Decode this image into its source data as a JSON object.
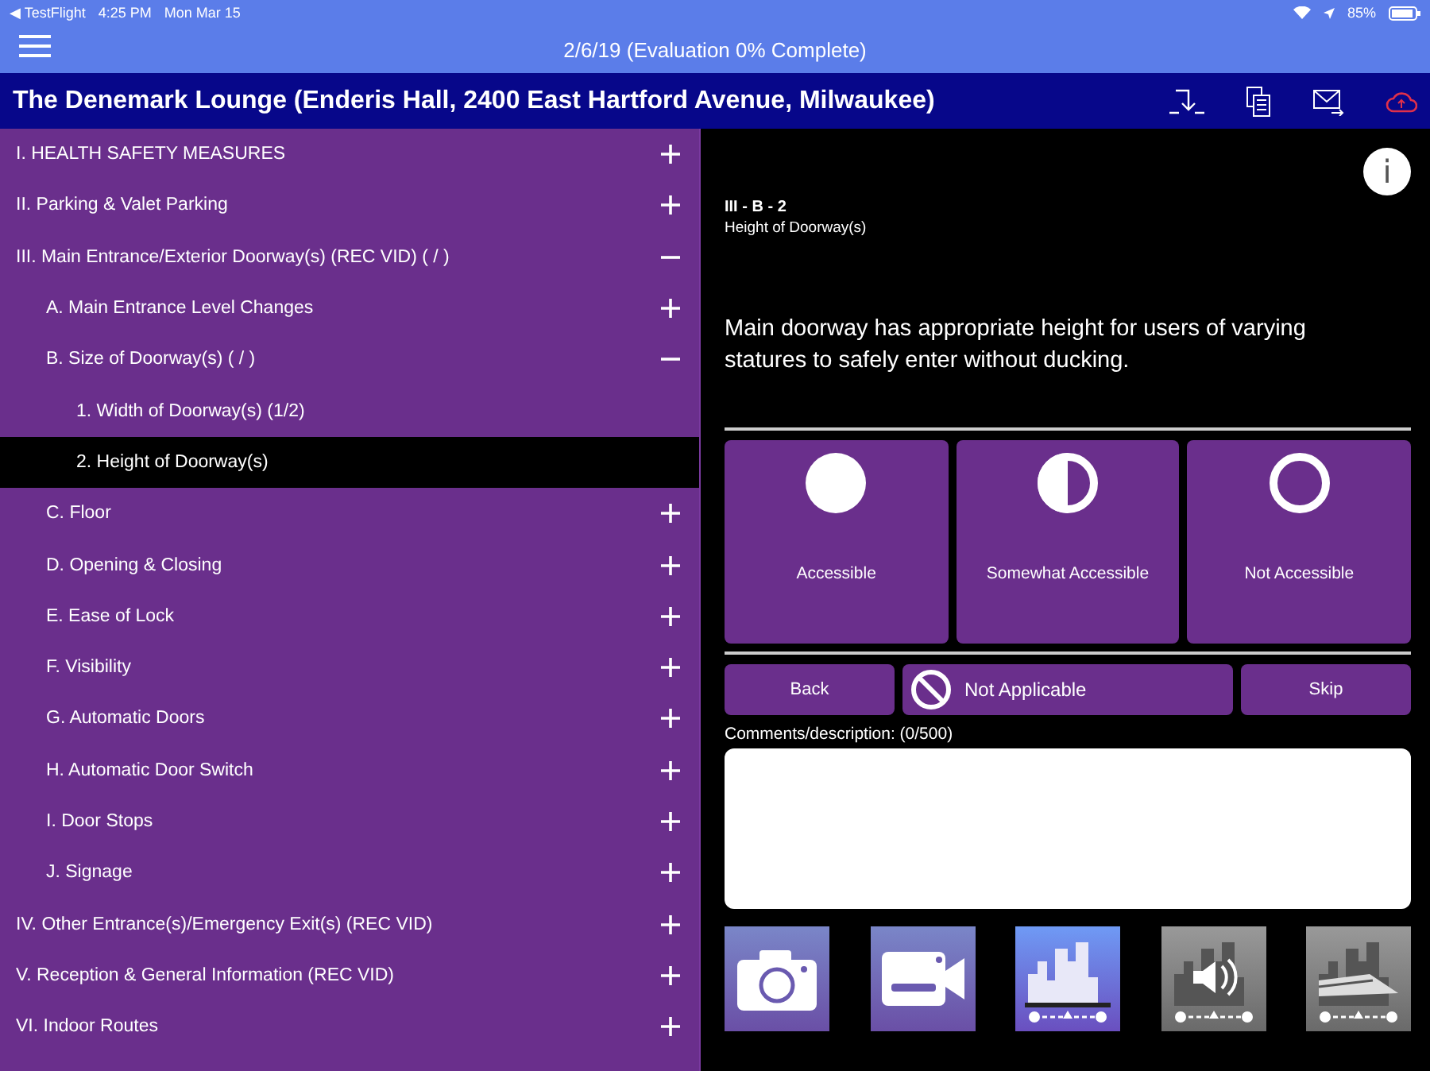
{
  "status_bar": {
    "back_app": "◀ TestFlight",
    "time": "4:25 PM",
    "date": "Mon Mar 15",
    "battery": "85%"
  },
  "nav_bar": {
    "title": "2/6/19 (Evaluation 0% Complete)"
  },
  "header": {
    "title": "The Denemark Lounge (Enderis Hall, 2400 East Hartford Avenue, Milwaukee)"
  },
  "sidebar": {
    "items": [
      {
        "label": "I. HEALTH SAFETY MEASURES",
        "expanded": false,
        "selected": false
      },
      {
        "label": "II. Parking & Valet Parking",
        "expanded": false,
        "selected": false
      },
      {
        "label": "III. Main Entrance/Exterior Doorway(s) (REC VID) ( / )",
        "expanded": true,
        "selected": false,
        "children": [
          {
            "label": "A.  Main Entrance Level Changes",
            "expanded": false,
            "selected": false
          },
          {
            "label": "B.  Size of Doorway(s) ( / )",
            "expanded": true,
            "selected": false,
            "children": [
              {
                "label": "1.  Width of Doorway(s) (1/2)",
                "kind": "question",
                "selected": false
              },
              {
                "label": "2.  Height of Doorway(s)",
                "kind": "question",
                "selected": true
              }
            ]
          },
          {
            "label": "C.  Floor",
            "expanded": false,
            "selected": false
          },
          {
            "label": "D.  Opening & Closing",
            "expanded": false,
            "selected": false
          },
          {
            "label": "E.  Ease of Lock",
            "expanded": false,
            "selected": false
          },
          {
            "label": "F.  Visibility",
            "expanded": false,
            "selected": false
          },
          {
            "label": "G.  Automatic Doors",
            "expanded": false,
            "selected": false
          },
          {
            "label": "H.  Automatic Door Switch",
            "expanded": false,
            "selected": false
          },
          {
            "label": "I.  Door Stops",
            "expanded": false,
            "selected": false
          },
          {
            "label": "J.  Signage",
            "expanded": false,
            "selected": false
          }
        ]
      },
      {
        "label": "IV. Other Entrance(s)/Emergency Exit(s) (REC VID)",
        "expanded": false,
        "selected": false
      },
      {
        "label": "V. Reception & General Information (REC VID)",
        "expanded": false,
        "selected": false
      },
      {
        "label": "VI. Indoor Routes",
        "expanded": false,
        "selected": false
      }
    ]
  },
  "info_button": {
    "label": "i"
  },
  "question": {
    "code": "III - B - 2",
    "subtitle": "Height of Doorway(s)",
    "text": "Main doorway has appropriate height for users of varying statures to safely enter without ducking."
  },
  "ratings": [
    {
      "kind": "full",
      "label": "Accessible",
      "selected": false
    },
    {
      "kind": "half",
      "label": "Somewhat Accessible",
      "selected": false
    },
    {
      "kind": "empty",
      "label": "Not Accessible",
      "selected": false
    }
  ],
  "actions": [
    {
      "kind": "back",
      "label": "Back"
    },
    {
      "kind": "na",
      "label": "Not Applicable"
    },
    {
      "kind": "skip",
      "label": "Skip"
    }
  ],
  "comments": {
    "label": "Comments/description: (0/500)"
  },
  "media_tools": [
    {
      "kind": "camera",
      "enabled": true
    },
    {
      "kind": "video",
      "enabled": true
    },
    {
      "kind": "skyline",
      "enabled": true
    },
    {
      "kind": "sound",
      "enabled": false
    },
    {
      "kind": "train",
      "enabled": false
    }
  ]
}
